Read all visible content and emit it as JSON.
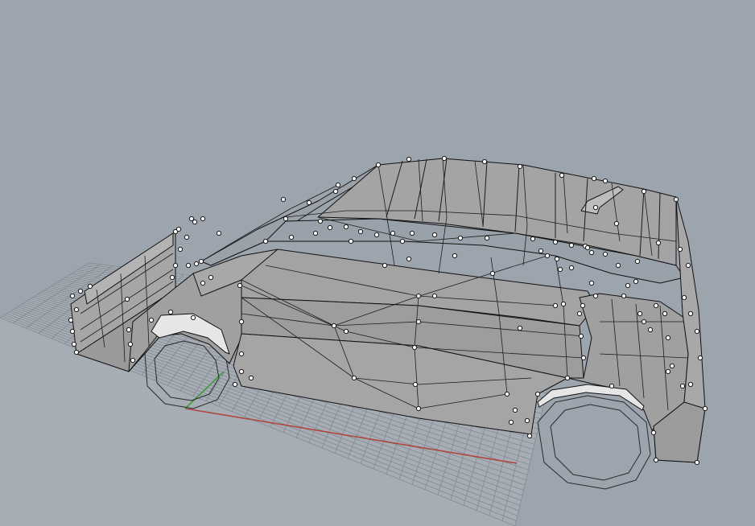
{
  "viewport": {
    "background": "#9ca4ad",
    "grid_color": "#7f868e",
    "grid_fill": "#a7adb4",
    "x_axis_color": "#b0463c",
    "y_axis_color": "#3f9a3a",
    "surface_color": "#a2a2a2",
    "surface_light": "#bdbdbd",
    "edge_color": "#111111",
    "control_point_color": "#ffffff"
  },
  "model": {
    "name": "car-body-mesh",
    "control_points_visible": true
  },
  "icons": {
    "axis_x": "x-axis-line",
    "axis_y": "y-axis-line"
  }
}
